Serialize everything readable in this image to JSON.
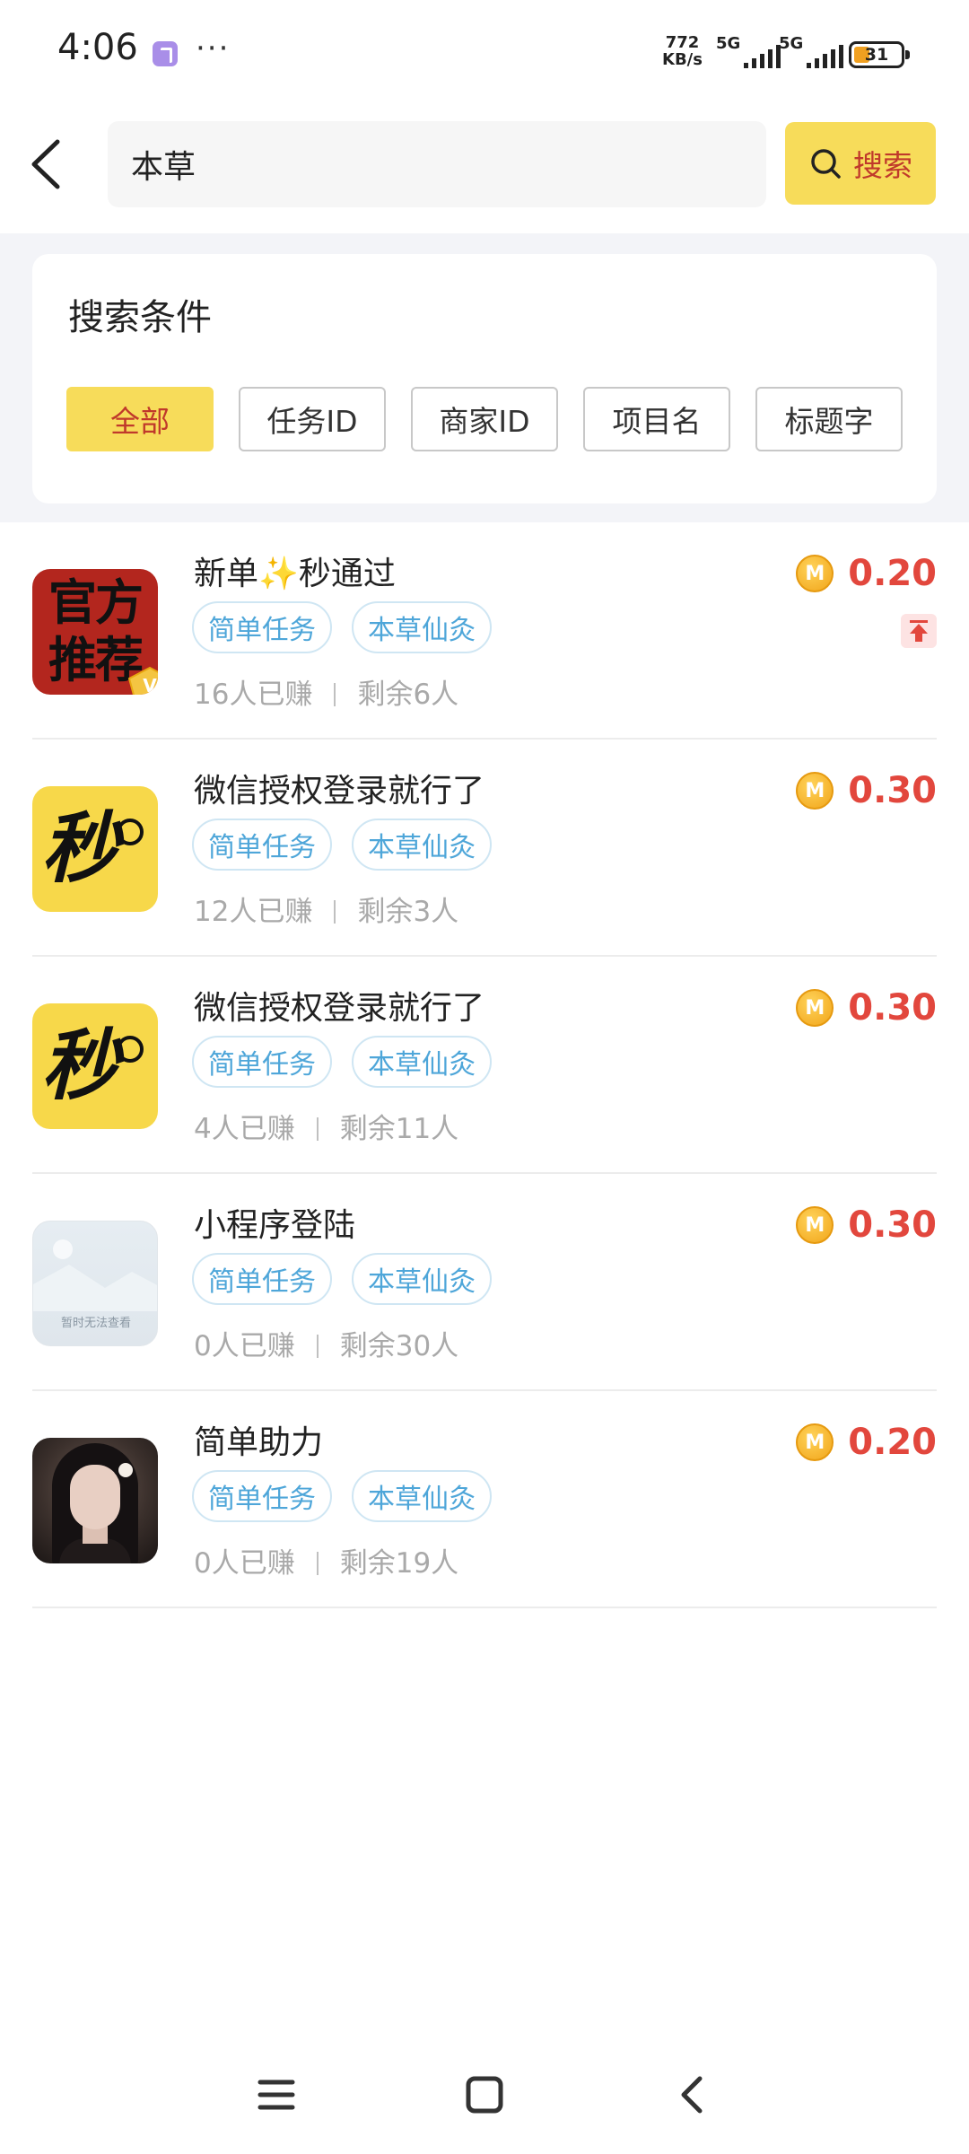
{
  "status_bar": {
    "time": "4:06",
    "net_speed_value": "772",
    "net_speed_unit": "KB/s",
    "signal_1": "5G",
    "signal_2": "5G",
    "battery": "31"
  },
  "search": {
    "value": "本草",
    "button_label": "搜索"
  },
  "conditions": {
    "title": "搜索条件",
    "chips": [
      "全部",
      "任务ID",
      "商家ID",
      "项目名",
      "标题字"
    ],
    "active_index": 0
  },
  "tasks": [
    {
      "title": "新单✨秒通过",
      "tags": [
        "简单任务",
        "本草仙灸"
      ],
      "earned": "16人已赚",
      "remaining": "剩余6人",
      "reward": "0.20",
      "thumb_text": "官方推荐"
    },
    {
      "title": "微信授权登录就行了",
      "tags": [
        "简单任务",
        "本草仙灸"
      ],
      "earned": "12人已赚",
      "remaining": "剩余3人",
      "reward": "0.30",
      "thumb_text": "秒"
    },
    {
      "title": "微信授权登录就行了",
      "tags": [
        "简单任务",
        "本草仙灸"
      ],
      "earned": "4人已赚",
      "remaining": "剩余11人",
      "reward": "0.30",
      "thumb_text": "秒"
    },
    {
      "title": "小程序登陆",
      "tags": [
        "简单任务",
        "本草仙灸"
      ],
      "earned": "0人已赚",
      "remaining": "剩余30人",
      "reward": "0.30",
      "thumb_text": "暂时无法查看"
    },
    {
      "title": "简单助力",
      "tags": [
        "简单任务",
        "本草仙灸"
      ],
      "earned": "0人已赚",
      "remaining": "剩余19人",
      "reward": "0.20"
    }
  ],
  "coin_label": "M",
  "colors": {
    "accent_yellow": "#f7dc5a",
    "price_red": "#e2473d",
    "tag_blue": "#4ea6d9"
  }
}
